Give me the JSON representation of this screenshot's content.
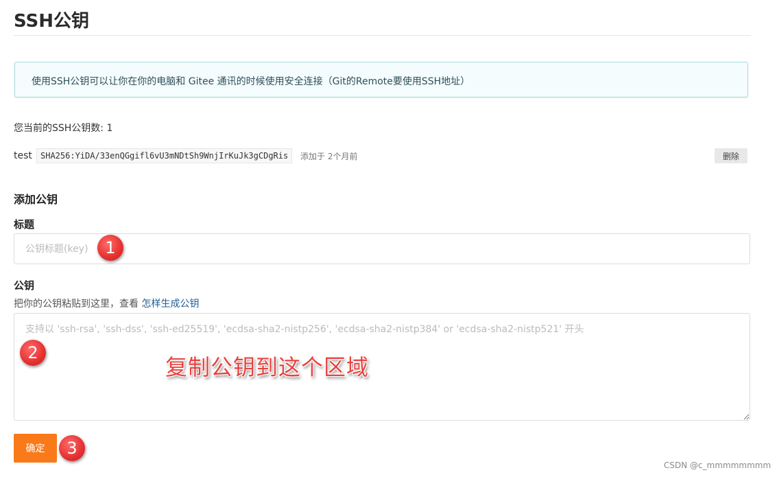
{
  "page": {
    "title": "SSH公钥"
  },
  "info_box": {
    "text": "使用SSH公钥可以让你在你的电脑和 Gitee 通讯的时候使用安全连接（Git的Remote要使用SSH地址）"
  },
  "keys": {
    "count_text": "您当前的SSH公钥数: 1",
    "items": [
      {
        "name": "test",
        "fingerprint": "SHA256:YiDA/33enQGgifl6vU3mNDtSh9WnjIrKuJk3gCDgRis",
        "added": "添加于 2个月前",
        "delete_label": "删除"
      }
    ]
  },
  "add_form": {
    "heading": "添加公钥",
    "title_label": "标题",
    "title_placeholder": "公钥标题(key)",
    "title_value": "",
    "key_label": "公钥",
    "key_hint": "把你的公钥粘贴到这里，查看 ",
    "key_hint_link": "怎样生成公钥",
    "key_placeholder": "支持以 'ssh-rsa', 'ssh-dss', 'ssh-ed25519', 'ecdsa-sha2-nistp256', 'ecdsa-sha2-nistp384' or 'ecdsa-sha2-nistp521' 开头",
    "key_value": "",
    "submit_label": "确定"
  },
  "annotations": {
    "marker_1": "1",
    "marker_2": "2",
    "marker_3": "3",
    "callout": "复制公钥到这个区域"
  },
  "watermark": "CSDN @c_mmmmmmmm",
  "colors": {
    "accent": "#fa7a19",
    "info_border": "#a6dcdf",
    "info_bg": "#f5fcfd",
    "link": "#1f5d95",
    "marker": "#e53030",
    "callout": "#e8423f"
  }
}
